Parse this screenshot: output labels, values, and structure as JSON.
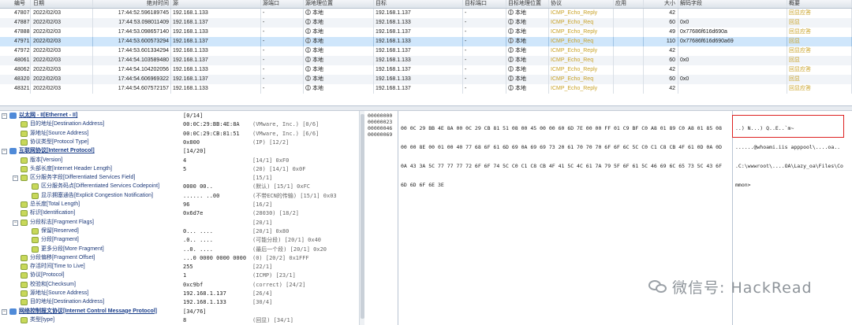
{
  "packet_list": {
    "headers": {
      "id": "编号",
      "date": "日期",
      "time": "绝对时间",
      "src": "源",
      "src_port": "源端口",
      "src_loc": "源地理位置",
      "dst": "目标",
      "dst_port": "目标端口",
      "dst_loc": "目标地理位置",
      "protocol": "协议",
      "app": "应用",
      "size": "大小",
      "decode": "解码字段",
      "summary": "概要"
    },
    "rows": [
      {
        "id": "47807",
        "date": "2022/02/03",
        "time": "17:44:52.596189745",
        "src": "192.168.1.133",
        "src_port": "-",
        "src_loc": "本地",
        "dst": "192.168.1.137",
        "dst_port": "-",
        "dst_loc": "本地",
        "protocol": "ICMP_Echo_Reply",
        "app": "",
        "size": "42",
        "decode": "",
        "summary": "回显应答"
      },
      {
        "id": "47887",
        "date": "2022/02/03",
        "time": "17:44:53.098011409",
        "src": "192.168.1.137",
        "src_port": "-",
        "src_loc": "本地",
        "dst": "192.168.1.133",
        "dst_port": "-",
        "dst_loc": "本地",
        "protocol": "ICMP_Echo_Req",
        "app": "",
        "size": "60",
        "decode": "0x0",
        "summary": "回显"
      },
      {
        "id": "47888",
        "date": "2022/02/03",
        "time": "17:44:53.098657140",
        "src": "192.168.1.133",
        "src_port": "-",
        "src_loc": "本地",
        "dst": "192.168.1.137",
        "dst_port": "-",
        "dst_loc": "本地",
        "protocol": "ICMP_Echo_Reply",
        "app": "",
        "size": "49",
        "decode": "0x77686f616d690a",
        "summary": "回显应答"
      },
      {
        "id": "47971",
        "date": "2022/02/03",
        "time": "17:44:53.600573294",
        "src": "192.168.1.137",
        "src_port": "-",
        "src_loc": "本地",
        "dst": "192.168.1.133",
        "dst_port": "-",
        "dst_loc": "本地",
        "protocol": "ICMP_Echo_Req",
        "app": "",
        "size": "110",
        "decode": "0x77686f616d690a69",
        "summary": "回显"
      },
      {
        "id": "47972",
        "date": "2022/02/03",
        "time": "17:44:53.601334294",
        "src": "192.168.1.133",
        "src_port": "-",
        "src_loc": "本地",
        "dst": "192.168.1.137",
        "dst_port": "-",
        "dst_loc": "本地",
        "protocol": "ICMP_Echo_Reply",
        "app": "",
        "size": "42",
        "decode": "",
        "summary": "回显应答"
      },
      {
        "id": "48061",
        "date": "2022/02/03",
        "time": "17:44:54.103589480",
        "src": "192.168.1.137",
        "src_port": "-",
        "src_loc": "本地",
        "dst": "192.168.1.133",
        "dst_port": "-",
        "dst_loc": "本地",
        "protocol": "ICMP_Echo_Req",
        "app": "",
        "size": "60",
        "decode": "0x0",
        "summary": "回显"
      },
      {
        "id": "48062",
        "date": "2022/02/03",
        "time": "17:44:54.104202056",
        "src": "192.168.1.133",
        "src_port": "-",
        "src_loc": "本地",
        "dst": "192.168.1.137",
        "dst_port": "-",
        "dst_loc": "本地",
        "protocol": "ICMP_Echo_Reply",
        "app": "",
        "size": "42",
        "decode": "",
        "summary": "回显应答"
      },
      {
        "id": "48320",
        "date": "2022/02/03",
        "time": "17:44:54.606969322",
        "src": "192.168.1.137",
        "src_port": "-",
        "src_loc": "本地",
        "dst": "192.168.1.133",
        "dst_port": "-",
        "dst_loc": "本地",
        "protocol": "ICMP_Echo_Req",
        "app": "",
        "size": "60",
        "decode": "0x0",
        "summary": "回显"
      },
      {
        "id": "48321",
        "date": "2022/02/03",
        "time": "17:44:54.607572157",
        "src": "192.168.1.133",
        "src_port": "-",
        "src_loc": "本地",
        "dst": "192.168.1.137",
        "dst_port": "-",
        "dst_loc": "本地",
        "protocol": "ICMP_Echo_Reply",
        "app": "",
        "size": "42",
        "decode": "",
        "summary": "回显应答"
      }
    ],
    "selected_id": "47971"
  },
  "decode_tree": {
    "rows": [
      {
        "type": "section",
        "field": "以太网 - II[Ethernet - II]",
        "value": "[0/14]"
      },
      {
        "type": "field",
        "field": "目的地址[Destination Address]",
        "value": "00:0C:29:BB:4E:8A",
        "extra": "(VMware, Inc.)  [0/6]"
      },
      {
        "type": "field",
        "field": "源地址[Source Address]",
        "value": "00:0C:29:CB:81:51",
        "extra": "(VMware, Inc.)  [6/6]"
      },
      {
        "type": "field",
        "field": "协议类型[Protocol Type]",
        "value": "0x800",
        "extra": "(IP)  [12/2]"
      },
      {
        "type": "section",
        "field": "互联网协议[Internet Protocol]",
        "value": "[14/20]"
      },
      {
        "type": "field",
        "field": "版本[Version]",
        "value": "4",
        "extra": "[14/1]  0xF0"
      },
      {
        "type": "field",
        "field": "头部长度[Internet Header Length]",
        "value": "5",
        "extra": "(20)  [14/1]  0x0F"
      },
      {
        "type": "field",
        "field": "区分服务字段[Differentiated Services Field]",
        "value": "",
        "extra": "[15/1]"
      },
      {
        "type": "subfield",
        "field": "区分服务码点[Differentiated Services Codepoint]",
        "value": "0000 00..",
        "extra": "(默认)  [15/1]  0xFC"
      },
      {
        "type": "subfield",
        "field": "显示拥塞通告[Explicit Congestion Notification]",
        "value": "...... ..00",
        "extra": "(不带ECN的传输)  [15/1]  0x03"
      },
      {
        "type": "field",
        "field": "总长度[Total Length]",
        "value": "96",
        "extra": "[16/2]"
      },
      {
        "type": "field",
        "field": "标识[Identification]",
        "value": "0x6d7e",
        "extra": "(28030)  [18/2]"
      },
      {
        "type": "field",
        "field": "分段标志[Fragment Flags]",
        "value": "",
        "extra": "[20/1]"
      },
      {
        "type": "subfield",
        "field": "保留[Reserved]",
        "value": "0... ....",
        "extra": "[20/1]  0x80"
      },
      {
        "type": "subfield",
        "field": "分段[Fragment]",
        "value": ".0.. ....",
        "extra": "(可能分段)  [20/1]  0x40"
      },
      {
        "type": "subfield",
        "field": "更多分段[More Fragment]",
        "value": "..0. ....",
        "extra": "(最后一个段)  [20/1]  0x20"
      },
      {
        "type": "field",
        "field": "分段偏移[Fragment Offset]",
        "value": "...0 0000 0000 0000",
        "extra": "(0)  [20/2]  0x1FFF"
      },
      {
        "type": "field",
        "field": "存活时间[Time to Live]",
        "value": "255",
        "extra": "[22/1]"
      },
      {
        "type": "field",
        "field": "协议[Protocol]",
        "value": "1",
        "extra": "(ICMP)  [23/1]"
      },
      {
        "type": "field",
        "field": "校验和[Checksum]",
        "value": "0xc9bf",
        "extra": "(correct)  [24/2]"
      },
      {
        "type": "field",
        "field": "源地址[Source Address]",
        "value": "192.168.1.137",
        "extra": "[26/4]"
      },
      {
        "type": "field",
        "field": "目的地址[Destination Address]",
        "value": "192.168.1.133",
        "extra": "[30/4]"
      },
      {
        "type": "section",
        "field": "网络控制报文协议[Internet Control Message Protocol]",
        "value": "[34/76]"
      },
      {
        "type": "field",
        "field": "类型[type]",
        "value": "8",
        "extra": "(回显)  [34/1]"
      }
    ]
  },
  "hex_pane": {
    "offsets": [
      "00000000",
      "00000023",
      "00000046",
      "00000069"
    ],
    "bytes": [
      "00 0C 29 BB 4E 8A 00 0C 29 CB 81 51 08 00 45 00 00 60 6D 7E 00 00 FF 01 C9 BF C0 A8 01 89 C0 A8 01 85 08",
      "00 00 8E 00 01 00 40 77 68 6F 61 6D 69 0A 69 69 73 20 61 70 70 70 6F 6F 6C 5C C0 C1 C8 CB 4F 61 0D 0A 0D",
      "0A 43 3A 5C 77 77 77 72 6F 6F 74 5C C0 C1 C8 CB 4F 41 5C 4C 61 7A 79 5F 6F 61 5C 46 69 6C 65 73 5C 43 6F",
      "6D 6D 6F 6E 3E"
    ],
    "ascii": [
      "..) N...) Q..E..`m~",
      "......@whoami.iis apppool\\....oa..",
      ".C:\\wwwroot\\....OA\\Lazy_oa\\Files\\Co",
      "mmon>"
    ]
  },
  "watermark": {
    "text": "微信号: HackRead",
    "icon": "wechat-icon"
  },
  "colors": {
    "protocol_text": "#c9a227",
    "summary_text": "#c9a227",
    "selected_row": "#cfe6fb",
    "section_text": "#1a3e8a",
    "highlight_box": "#dd2222"
  }
}
